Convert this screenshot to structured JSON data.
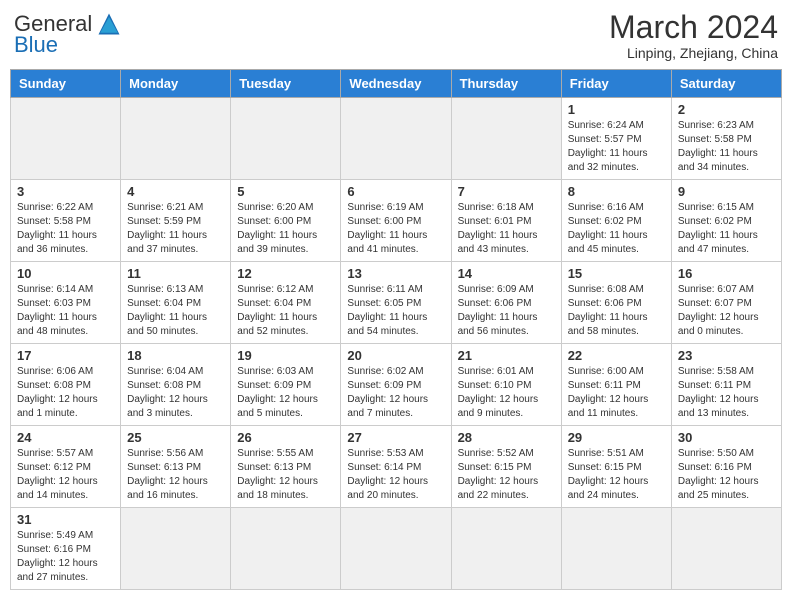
{
  "header": {
    "logo_general": "General",
    "logo_blue": "Blue",
    "month_title": "March 2024",
    "subtitle": "Linping, Zhejiang, China"
  },
  "days_of_week": [
    "Sunday",
    "Monday",
    "Tuesday",
    "Wednesday",
    "Thursday",
    "Friday",
    "Saturday"
  ],
  "weeks": [
    [
      {
        "day": "",
        "info": "",
        "empty": true
      },
      {
        "day": "",
        "info": "",
        "empty": true
      },
      {
        "day": "",
        "info": "",
        "empty": true
      },
      {
        "day": "",
        "info": "",
        "empty": true
      },
      {
        "day": "",
        "info": "",
        "empty": true
      },
      {
        "day": "1",
        "info": "Sunrise: 6:24 AM\nSunset: 5:57 PM\nDaylight: 11 hours and 32 minutes."
      },
      {
        "day": "2",
        "info": "Sunrise: 6:23 AM\nSunset: 5:58 PM\nDaylight: 11 hours and 34 minutes."
      }
    ],
    [
      {
        "day": "3",
        "info": "Sunrise: 6:22 AM\nSunset: 5:58 PM\nDaylight: 11 hours and 36 minutes."
      },
      {
        "day": "4",
        "info": "Sunrise: 6:21 AM\nSunset: 5:59 PM\nDaylight: 11 hours and 37 minutes."
      },
      {
        "day": "5",
        "info": "Sunrise: 6:20 AM\nSunset: 6:00 PM\nDaylight: 11 hours and 39 minutes."
      },
      {
        "day": "6",
        "info": "Sunrise: 6:19 AM\nSunset: 6:00 PM\nDaylight: 11 hours and 41 minutes."
      },
      {
        "day": "7",
        "info": "Sunrise: 6:18 AM\nSunset: 6:01 PM\nDaylight: 11 hours and 43 minutes."
      },
      {
        "day": "8",
        "info": "Sunrise: 6:16 AM\nSunset: 6:02 PM\nDaylight: 11 hours and 45 minutes."
      },
      {
        "day": "9",
        "info": "Sunrise: 6:15 AM\nSunset: 6:02 PM\nDaylight: 11 hours and 47 minutes."
      }
    ],
    [
      {
        "day": "10",
        "info": "Sunrise: 6:14 AM\nSunset: 6:03 PM\nDaylight: 11 hours and 48 minutes."
      },
      {
        "day": "11",
        "info": "Sunrise: 6:13 AM\nSunset: 6:04 PM\nDaylight: 11 hours and 50 minutes."
      },
      {
        "day": "12",
        "info": "Sunrise: 6:12 AM\nSunset: 6:04 PM\nDaylight: 11 hours and 52 minutes."
      },
      {
        "day": "13",
        "info": "Sunrise: 6:11 AM\nSunset: 6:05 PM\nDaylight: 11 hours and 54 minutes."
      },
      {
        "day": "14",
        "info": "Sunrise: 6:09 AM\nSunset: 6:06 PM\nDaylight: 11 hours and 56 minutes."
      },
      {
        "day": "15",
        "info": "Sunrise: 6:08 AM\nSunset: 6:06 PM\nDaylight: 11 hours and 58 minutes."
      },
      {
        "day": "16",
        "info": "Sunrise: 6:07 AM\nSunset: 6:07 PM\nDaylight: 12 hours and 0 minutes."
      }
    ],
    [
      {
        "day": "17",
        "info": "Sunrise: 6:06 AM\nSunset: 6:08 PM\nDaylight: 12 hours and 1 minute."
      },
      {
        "day": "18",
        "info": "Sunrise: 6:04 AM\nSunset: 6:08 PM\nDaylight: 12 hours and 3 minutes."
      },
      {
        "day": "19",
        "info": "Sunrise: 6:03 AM\nSunset: 6:09 PM\nDaylight: 12 hours and 5 minutes."
      },
      {
        "day": "20",
        "info": "Sunrise: 6:02 AM\nSunset: 6:09 PM\nDaylight: 12 hours and 7 minutes."
      },
      {
        "day": "21",
        "info": "Sunrise: 6:01 AM\nSunset: 6:10 PM\nDaylight: 12 hours and 9 minutes."
      },
      {
        "day": "22",
        "info": "Sunrise: 6:00 AM\nSunset: 6:11 PM\nDaylight: 12 hours and 11 minutes."
      },
      {
        "day": "23",
        "info": "Sunrise: 5:58 AM\nSunset: 6:11 PM\nDaylight: 12 hours and 13 minutes."
      }
    ],
    [
      {
        "day": "24",
        "info": "Sunrise: 5:57 AM\nSunset: 6:12 PM\nDaylight: 12 hours and 14 minutes."
      },
      {
        "day": "25",
        "info": "Sunrise: 5:56 AM\nSunset: 6:13 PM\nDaylight: 12 hours and 16 minutes."
      },
      {
        "day": "26",
        "info": "Sunrise: 5:55 AM\nSunset: 6:13 PM\nDaylight: 12 hours and 18 minutes."
      },
      {
        "day": "27",
        "info": "Sunrise: 5:53 AM\nSunset: 6:14 PM\nDaylight: 12 hours and 20 minutes."
      },
      {
        "day": "28",
        "info": "Sunrise: 5:52 AM\nSunset: 6:15 PM\nDaylight: 12 hours and 22 minutes."
      },
      {
        "day": "29",
        "info": "Sunrise: 5:51 AM\nSunset: 6:15 PM\nDaylight: 12 hours and 24 minutes."
      },
      {
        "day": "30",
        "info": "Sunrise: 5:50 AM\nSunset: 6:16 PM\nDaylight: 12 hours and 25 minutes."
      }
    ],
    [
      {
        "day": "31",
        "info": "Sunrise: 5:49 AM\nSunset: 6:16 PM\nDaylight: 12 hours and 27 minutes."
      },
      {
        "day": "",
        "info": "",
        "empty": true
      },
      {
        "day": "",
        "info": "",
        "empty": true
      },
      {
        "day": "",
        "info": "",
        "empty": true
      },
      {
        "day": "",
        "info": "",
        "empty": true
      },
      {
        "day": "",
        "info": "",
        "empty": true
      },
      {
        "day": "",
        "info": "",
        "empty": true
      }
    ]
  ]
}
